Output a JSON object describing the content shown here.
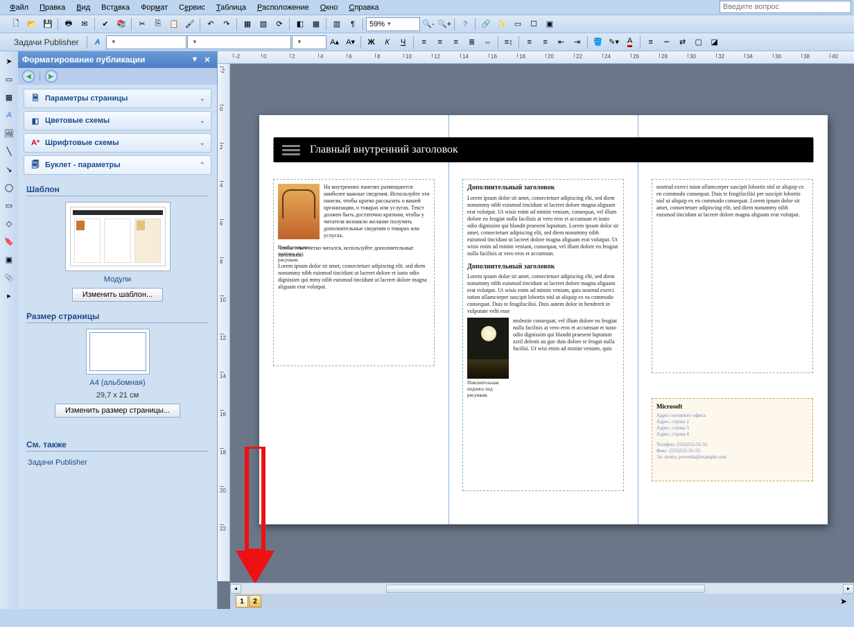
{
  "menu": {
    "file": "Файл",
    "edit": "Правка",
    "view": "Вид",
    "insert": "Вставка",
    "format": "Формат",
    "service": "Сервис",
    "table": "Таблица",
    "layout": "Расположение",
    "window": "Окно",
    "help": "Справка"
  },
  "question_placeholder": "Введите вопрос",
  "zoom_value": "59%",
  "publisher_tasks_label": "Задачи Publisher",
  "task_pane": {
    "title": "Форматирование публикации",
    "acc1": "Параметры страницы",
    "acc2": "Цветовые схемы",
    "acc3": "Шрифтовые схемы",
    "acc4": "Буклет - параметры",
    "template_section": "Шаблон",
    "template_name": "Модули",
    "change_template_btn": "Изменить шаблон...",
    "pagesize_section": "Размер страницы",
    "pagesize_name": "A4 (альбомная)",
    "pagesize_dims": "29,7 x 21 см",
    "change_pagesize_btn": "Изменить размер страницы...",
    "see_also": "См. также",
    "see_link1": "Задачи Publisher"
  },
  "ruler_h_ticks": [
    "-2",
    "0",
    "2",
    "4",
    "6",
    "8",
    "10",
    "12",
    "14",
    "16",
    "18",
    "20",
    "22",
    "24",
    "26",
    "28",
    "30",
    "32",
    "34",
    "36",
    "38",
    "40"
  ],
  "ruler_v_ticks": [
    "-2",
    "0",
    "2",
    "4",
    "6",
    "8",
    "10",
    "12",
    "14",
    "16",
    "18",
    "20",
    "22"
  ],
  "doc": {
    "main_title": "Главный внутренний заголовок",
    "col1_body": "На внутренних панелях размещаются наиболее важные сведения. Используйте эти панели, чтобы кратко рассказать о вашей организации, о товарах или услугах. Текст должен быть достаточно кратким, чтобы у читателя возникло желание получить дополнительные сведения о товарах или услугах.",
    "col1_caption": "Пояснительная подпись под рисунком.",
    "col1_body2": "Чтобы текст легко читался, используйте дополнительные заголовки.",
    "col1_body3": "Lorem ipsum dolor sit amet, consectetuer adipiscing elit, sed diem nonummy nibh euismod tincidunt ut lacreet dolore et iusto odio dignissim qui mmy nibh euismod tincidunt ut lacreet dolore magna aliguam erat volutpat.",
    "col2_h1": "Дополнительный заголовок",
    "col2_b1": "Lorem ipsum dolor sit amet, consectetuer adipiscing elit, sed diem nonummy nibh euismod tincidunt ut lacreet dolore magna aliguam erat volutpat. Ut wisis enim ad minim veniam, consequat, vel illum dolore eu feugiat nulla facilisis at vero eros et accumsan et iusto odio dignissim qui blandit praesent luptatum. Lorem ipsum dolor sit amet, consectetuer adipiscing elit, sed diem nonummy nibh euismod tincidunt ut lacreet dolore magna aliguam erat volutpat. Ut wisis enim ad minim veniam, consequat, vel illum dolore eu feugiat nulla facilisis at vero eros et accumsan.",
    "col2_h2": "Дополнительный заголовок",
    "col2_b2a": "Lorem ipsum dolor sit amet, consectetuer adipiscing elit, sed diem nonummy nibh euismod tincidunt ut lacreet dolore magna aliguam erat volutpat. Ut wisis enim ad minim veniam, quis nostrud exerci tution ullamcorper suscipit lobortis nisl ut aliquip ex ea commodo consequat. Duis te feugifacilisi. Duis autem dolor in hendrerit in vulputate velit esse",
    "col2_caption": "Пояснительная подпись под рисунком.",
    "col2_b2b": "molestie consequat, vel illum dolore eu feugiat nulla facilisis at vero eros et accumsan et iusto odio dignissim qui blandit praesent luptatum zzril delenit au gue duis dolore te feugat nulla facilisi. Ut wisi enim ad minim veniam, quis",
    "col3_body": "nostrud exerci taion ullamcorper suscipit lobortis nisl ut aliquip ex en commodo consequat. Duis te feugifacilisi per suscipit lobortis nisl ut aliquip ex en commodo consequat. Lorem ipsum dolor sit amet, consectetuer adipiscing elit, sed diem nonummy nibh euismod tincidunt ut lacreet dolore magna aliguam erat volutpat.",
    "contact": {
      "brand": "Microsoft",
      "l1": "Адрес основного офиса",
      "l2": "Адрес, строка 2",
      "l3": "Адрес, строка 3",
      "l4": "Адрес, строка 4",
      "l5": "Телефон: (555)555-55-55",
      "l6": "Факс: (555)555-55-55",
      "l7": "Эл. почта: proverka@example.com"
    }
  },
  "pages": {
    "p1": "1",
    "p2": "2"
  }
}
